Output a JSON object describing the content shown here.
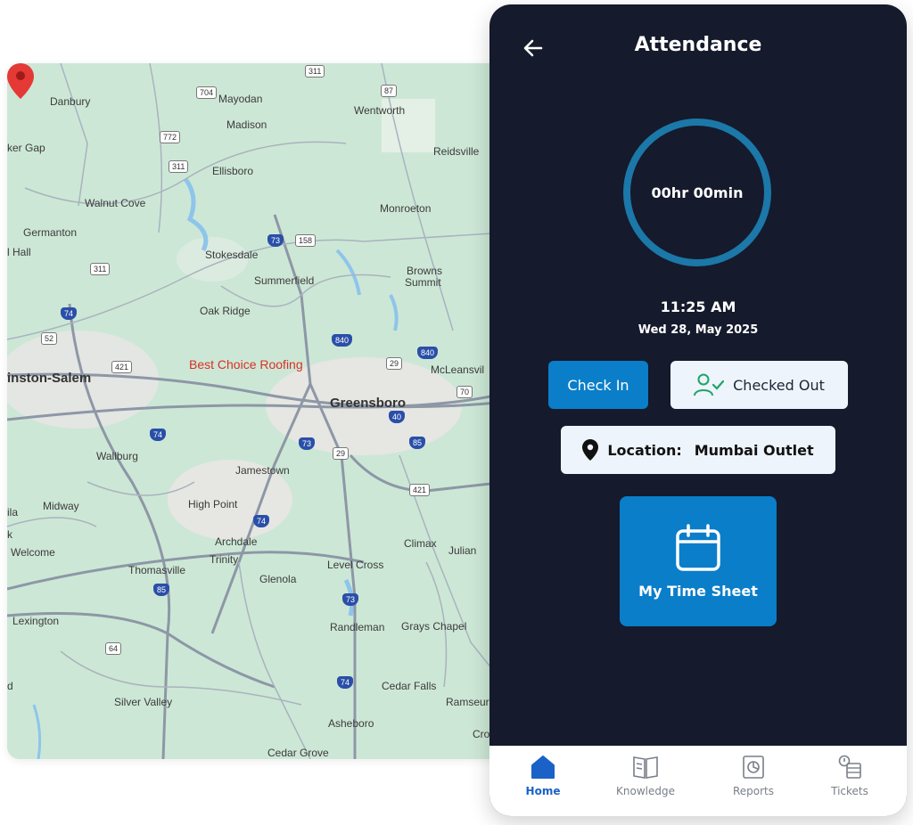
{
  "map": {
    "poi_label": "Best Choice Roofing",
    "places": [
      {
        "name": "Danbury",
        "big": false
      },
      {
        "name": "Mayodan",
        "big": false
      },
      {
        "name": "Madison",
        "big": false
      },
      {
        "name": "Wentworth",
        "big": false
      },
      {
        "name": "ker Gap",
        "big": false
      },
      {
        "name": "Reidsville",
        "big": false
      },
      {
        "name": "Ellisboro",
        "big": false
      },
      {
        "name": "Walnut Cove",
        "big": false
      },
      {
        "name": "Monroeton",
        "big": false
      },
      {
        "name": "Germanton",
        "big": false
      },
      {
        "name": "l Hall",
        "big": false
      },
      {
        "name": "Stokesdale",
        "big": false
      },
      {
        "name": "Browns",
        "big": false
      },
      {
        "name": "Summit",
        "big": false
      },
      {
        "name": "Summerfield",
        "big": false
      },
      {
        "name": "Oak Ridge",
        "big": false
      },
      {
        "name": "inston-Salem",
        "big": true
      },
      {
        "name": "Greensboro",
        "big": true
      },
      {
        "name": "McLeansvil",
        "big": false
      },
      {
        "name": "Wallburg",
        "big": false
      },
      {
        "name": "Jamestown",
        "big": false
      },
      {
        "name": "High Point",
        "big": false
      },
      {
        "name": "Midway",
        "big": false
      },
      {
        "name": "ila",
        "big": false
      },
      {
        "name": "Archdale",
        "big": false
      },
      {
        "name": "Climax",
        "big": false
      },
      {
        "name": "Julian",
        "big": false
      },
      {
        "name": "Welcome",
        "big": false
      },
      {
        "name": "Trinity",
        "big": false
      },
      {
        "name": "Thomasville",
        "big": false
      },
      {
        "name": "Level Cross",
        "big": false
      },
      {
        "name": "Glenola",
        "big": false
      },
      {
        "name": "Lexington",
        "big": false
      },
      {
        "name": "Randleman",
        "big": false
      },
      {
        "name": "Grays Chapel",
        "big": false
      },
      {
        "name": "Cedar Falls",
        "big": false
      },
      {
        "name": "Silver Valley",
        "big": false
      },
      {
        "name": "Ramseur",
        "big": false
      },
      {
        "name": "Asheboro",
        "big": false
      },
      {
        "name": "Cedar Grove",
        "big": false
      },
      {
        "name": "Cro",
        "big": false
      },
      {
        "name": "d",
        "big": false
      },
      {
        "name": "k",
        "big": false
      }
    ],
    "shields": [
      "311",
      "704",
      "87",
      "772",
      "311",
      "73",
      "158",
      "311",
      "74",
      "52",
      "421",
      "840",
      "840",
      "29",
      "70",
      "74",
      "40",
      "73",
      "29",
      "85",
      "421",
      "74",
      "85",
      "73",
      "64",
      "74"
    ]
  },
  "screen": {
    "title": "Attendance",
    "timer": "00hr 00min",
    "time": "11:25 AM",
    "date": "Wed 28, May 2025",
    "check_in_label": "Check In",
    "checked_out_label": "Checked Out",
    "location_key": "Location:",
    "location_value": "Mumbai Outlet",
    "timesheet_label": "My Time Sheet",
    "accent": "#0a7ec9",
    "background": "#151a2c"
  },
  "nav": {
    "items": [
      {
        "label": "Home",
        "icon": "home-icon",
        "active": true
      },
      {
        "label": "Knowledge",
        "icon": "book-icon",
        "active": false
      },
      {
        "label": "Reports",
        "icon": "report-icon",
        "active": false
      },
      {
        "label": "Tickets",
        "icon": "ticket-icon",
        "active": false
      }
    ]
  }
}
